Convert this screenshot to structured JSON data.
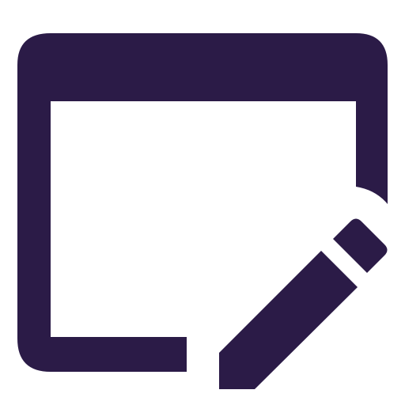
{
  "icon": {
    "name": "edit-window-icon",
    "color": "#2b1b47",
    "background": "#ffffff",
    "parts": [
      "window-icon",
      "pencil-icon"
    ]
  }
}
